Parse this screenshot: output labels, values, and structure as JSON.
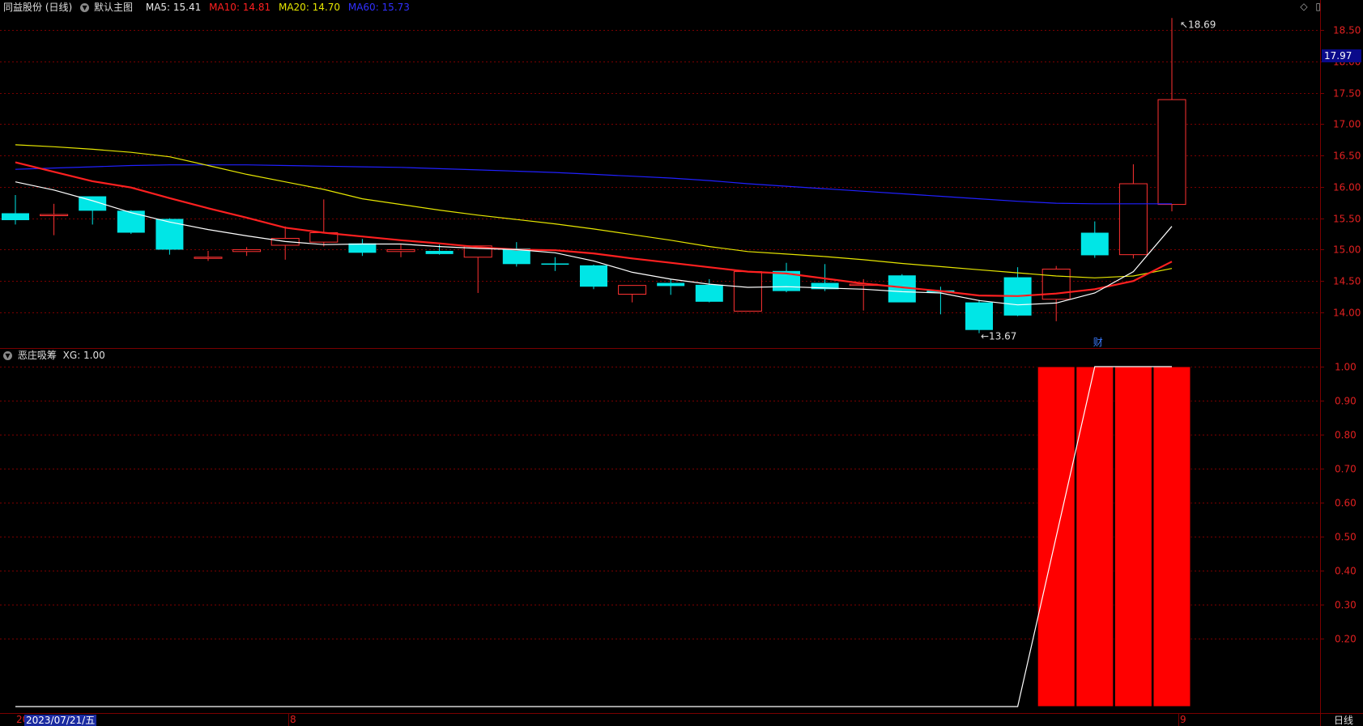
{
  "header": {
    "stock": "同益股份 (日线)",
    "template": "默认主图",
    "ma5": "MA5: 15.41",
    "ma10": "MA10: 14.81",
    "ma20": "MA20: 14.70",
    "ma60": "MA60: 15.73"
  },
  "colors": {
    "ma5": "#ffffff",
    "ma10": "#ff2020",
    "ma20": "#e6e600",
    "ma60": "#2020ff",
    "up": "#ff3232",
    "down": "#00e6e6",
    "grid": "#7a0000"
  },
  "indicator": {
    "name": "恶庄吸筹",
    "value": "XG: 1.00"
  },
  "last_price": "17.97",
  "markers": {
    "high": "18.69",
    "low": "13.67",
    "event": "财"
  },
  "x_labels": {
    "left": "20",
    "mid": "8",
    "right": "9",
    "cursor_date": "2023/07/21/五",
    "period": "日线"
  },
  "chart_data": [
    {
      "type": "candlestick",
      "ylim": [
        13.5,
        18.75
      ],
      "yticks": [
        "18.50",
        "18.00",
        "17.50",
        "17.00",
        "16.50",
        "16.00",
        "15.50",
        "15.00",
        "14.50",
        "14.00"
      ],
      "candles": [
        {
          "o": 15.58,
          "h": 15.87,
          "l": 15.4,
          "c": 15.47
        },
        {
          "o": 15.56,
          "h": 15.73,
          "l": 15.23,
          "c": 15.56
        },
        {
          "o": 15.85,
          "h": 15.85,
          "l": 15.4,
          "c": 15.62
        },
        {
          "o": 15.62,
          "h": 15.63,
          "l": 15.25,
          "c": 15.27
        },
        {
          "o": 15.49,
          "h": 15.5,
          "l": 14.92,
          "c": 15.0
        },
        {
          "o": 14.87,
          "h": 14.98,
          "l": 14.82,
          "c": 14.88
        },
        {
          "o": 14.97,
          "h": 15.04,
          "l": 14.9,
          "c": 15.0
        },
        {
          "o": 15.07,
          "h": 15.37,
          "l": 14.84,
          "c": 15.18
        },
        {
          "o": 15.12,
          "h": 15.8,
          "l": 15.05,
          "c": 15.27
        },
        {
          "o": 15.1,
          "h": 15.17,
          "l": 14.9,
          "c": 14.95
        },
        {
          "o": 14.97,
          "h": 15.08,
          "l": 14.88,
          "c": 15.0
        },
        {
          "o": 14.98,
          "h": 15.08,
          "l": 14.92,
          "c": 14.93
        },
        {
          "o": 14.88,
          "h": 15.05,
          "l": 14.31,
          "c": 15.06
        },
        {
          "o": 15.02,
          "h": 15.12,
          "l": 14.73,
          "c": 14.77
        },
        {
          "o": 14.78,
          "h": 14.88,
          "l": 14.66,
          "c": 14.76
        },
        {
          "o": 14.75,
          "h": 14.76,
          "l": 14.37,
          "c": 14.41
        },
        {
          "o": 14.29,
          "h": 14.43,
          "l": 14.16,
          "c": 14.43
        },
        {
          "o": 14.47,
          "h": 14.53,
          "l": 14.28,
          "c": 14.42
        },
        {
          "o": 14.44,
          "h": 14.53,
          "l": 14.16,
          "c": 14.17
        },
        {
          "o": 14.02,
          "h": 14.64,
          "l": 14.02,
          "c": 14.65
        },
        {
          "o": 14.66,
          "h": 14.79,
          "l": 14.32,
          "c": 14.34
        },
        {
          "o": 14.47,
          "h": 14.77,
          "l": 14.34,
          "c": 14.37
        },
        {
          "o": 14.43,
          "h": 14.53,
          "l": 14.03,
          "c": 14.45
        },
        {
          "o": 14.59,
          "h": 14.61,
          "l": 14.17,
          "c": 14.16
        },
        {
          "o": 14.35,
          "h": 14.41,
          "l": 13.97,
          "c": 14.32
        },
        {
          "o": 14.16,
          "h": 14.2,
          "l": 13.67,
          "c": 13.72
        },
        {
          "o": 14.56,
          "h": 14.72,
          "l": 13.94,
          "c": 13.95
        },
        {
          "o": 14.21,
          "h": 14.74,
          "l": 13.86,
          "c": 14.69
        },
        {
          "o": 15.27,
          "h": 15.45,
          "l": 14.87,
          "c": 14.91
        },
        {
          "o": 14.92,
          "h": 16.36,
          "l": 14.86,
          "c": 16.05
        },
        {
          "o": 15.72,
          "h": 18.69,
          "l": 15.61,
          "c": 17.39
        }
      ],
      "ma5": [
        16.08,
        15.95,
        15.78,
        15.59,
        15.44,
        15.32,
        15.22,
        15.13,
        15.08,
        15.09,
        15.09,
        15.05,
        15.02,
        15.0,
        14.95,
        14.82,
        14.64,
        14.53,
        14.45,
        14.4,
        14.41,
        14.39,
        14.37,
        14.33,
        14.31,
        14.19,
        14.12,
        14.15,
        14.31,
        14.65,
        15.37
      ],
      "ma10": [
        16.39,
        16.24,
        16.09,
        15.99,
        15.82,
        15.66,
        15.51,
        15.35,
        15.27,
        15.21,
        15.15,
        15.1,
        15.04,
        15.0,
        14.99,
        14.94,
        14.86,
        14.79,
        14.72,
        14.65,
        14.62,
        14.54,
        14.46,
        14.4,
        14.34,
        14.27,
        14.26,
        14.3,
        14.37,
        14.5,
        14.81
      ],
      "ma20": [
        16.67,
        16.64,
        16.6,
        16.55,
        16.48,
        16.34,
        16.2,
        16.08,
        15.96,
        15.81,
        15.72,
        15.63,
        15.55,
        15.48,
        15.41,
        15.33,
        15.24,
        15.15,
        15.05,
        14.97,
        14.93,
        14.89,
        14.84,
        14.78,
        14.73,
        14.68,
        14.63,
        14.58,
        14.55,
        14.58,
        14.7
      ],
      "ma60": [
        16.28,
        16.3,
        16.32,
        16.34,
        16.35,
        16.35,
        16.35,
        16.34,
        16.33,
        16.32,
        16.31,
        16.29,
        16.27,
        16.25,
        16.23,
        16.2,
        16.17,
        16.14,
        16.1,
        16.05,
        16.01,
        15.97,
        15.93,
        15.89,
        15.85,
        15.81,
        15.77,
        15.74,
        15.73,
        15.73,
        15.73
      ]
    },
    {
      "type": "bar",
      "name": "XG",
      "ylim": [
        0,
        1.04
      ],
      "yticks": [
        "1.00",
        "0.90",
        "0.80",
        "0.70",
        "0.60",
        "0.50",
        "0.40",
        "0.30",
        "0.20"
      ],
      "values": [
        0,
        0,
        0,
        0,
        0,
        0,
        0,
        0,
        0,
        0,
        0,
        0,
        0,
        0,
        0,
        0,
        0,
        0,
        0,
        0,
        0,
        0,
        0,
        0,
        0,
        0,
        0,
        1,
        1,
        1,
        1
      ],
      "line": [
        0,
        0,
        0,
        0,
        0,
        0,
        0,
        0,
        0,
        0,
        0,
        0,
        0,
        0,
        0,
        0,
        0,
        0,
        0,
        0,
        0,
        0,
        0,
        0,
        0,
        0,
        0,
        0.5,
        1,
        1,
        1
      ]
    }
  ]
}
